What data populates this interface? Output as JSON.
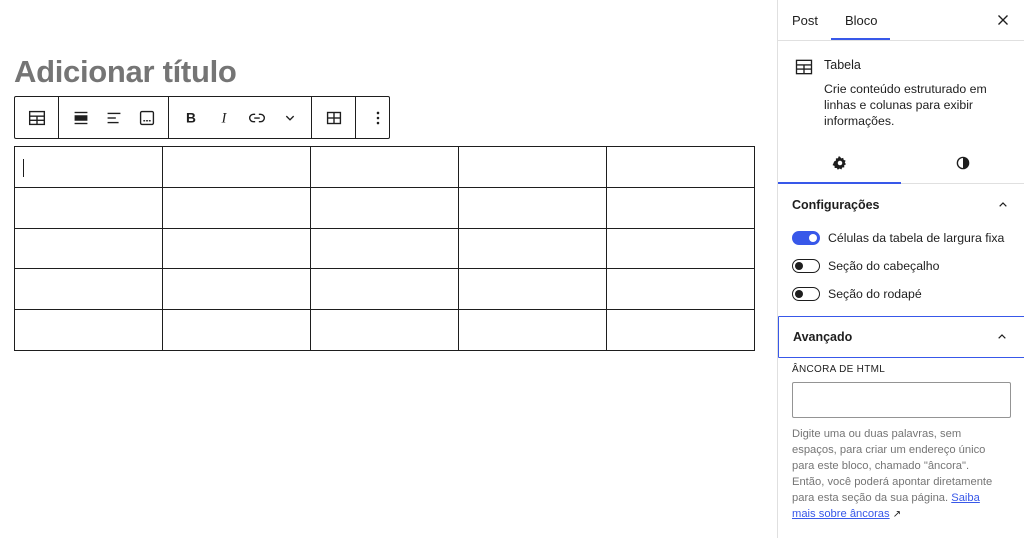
{
  "editor": {
    "title_placeholder": "Adicionar título",
    "toolbar": {
      "icons": [
        "table-icon",
        "align-wide-icon",
        "align-text-left-icon",
        "caption-icon",
        "bold-icon",
        "italic-icon",
        "link-icon",
        "chevron-down-icon",
        "edit-table-icon",
        "more-options-icon"
      ]
    },
    "table": {
      "rows": 5,
      "columns": 5
    }
  },
  "sidebar": {
    "tabs": {
      "post": "Post",
      "block": "Bloco",
      "active": "Bloco"
    },
    "block": {
      "name": "Tabela",
      "description": "Crie conteúdo estruturado em linhas e colunas para exibir informações."
    },
    "configuracoes": {
      "title": "Configurações",
      "toggles": [
        {
          "label": "Células da tabela de largura fixa",
          "on": true
        },
        {
          "label": "Seção do cabeçalho",
          "on": false
        },
        {
          "label": "Seção do rodapé",
          "on": false
        }
      ]
    },
    "avancado": {
      "title": "Avançado",
      "anchor_label": "ÂNCORA DE HTML",
      "anchor_value": "",
      "help_text": "Digite uma ou duas palavras, sem espaços, para criar um endereço único para este bloco, chamado \"âncora\". Então, você poderá apontar diretamente para esta seção da sua página.",
      "help_link": "Saiba mais sobre âncoras",
      "external_arrow": "↗"
    }
  },
  "colors": {
    "accent": "#3858e9",
    "text": "#1e1e1e",
    "muted": "#757575"
  }
}
